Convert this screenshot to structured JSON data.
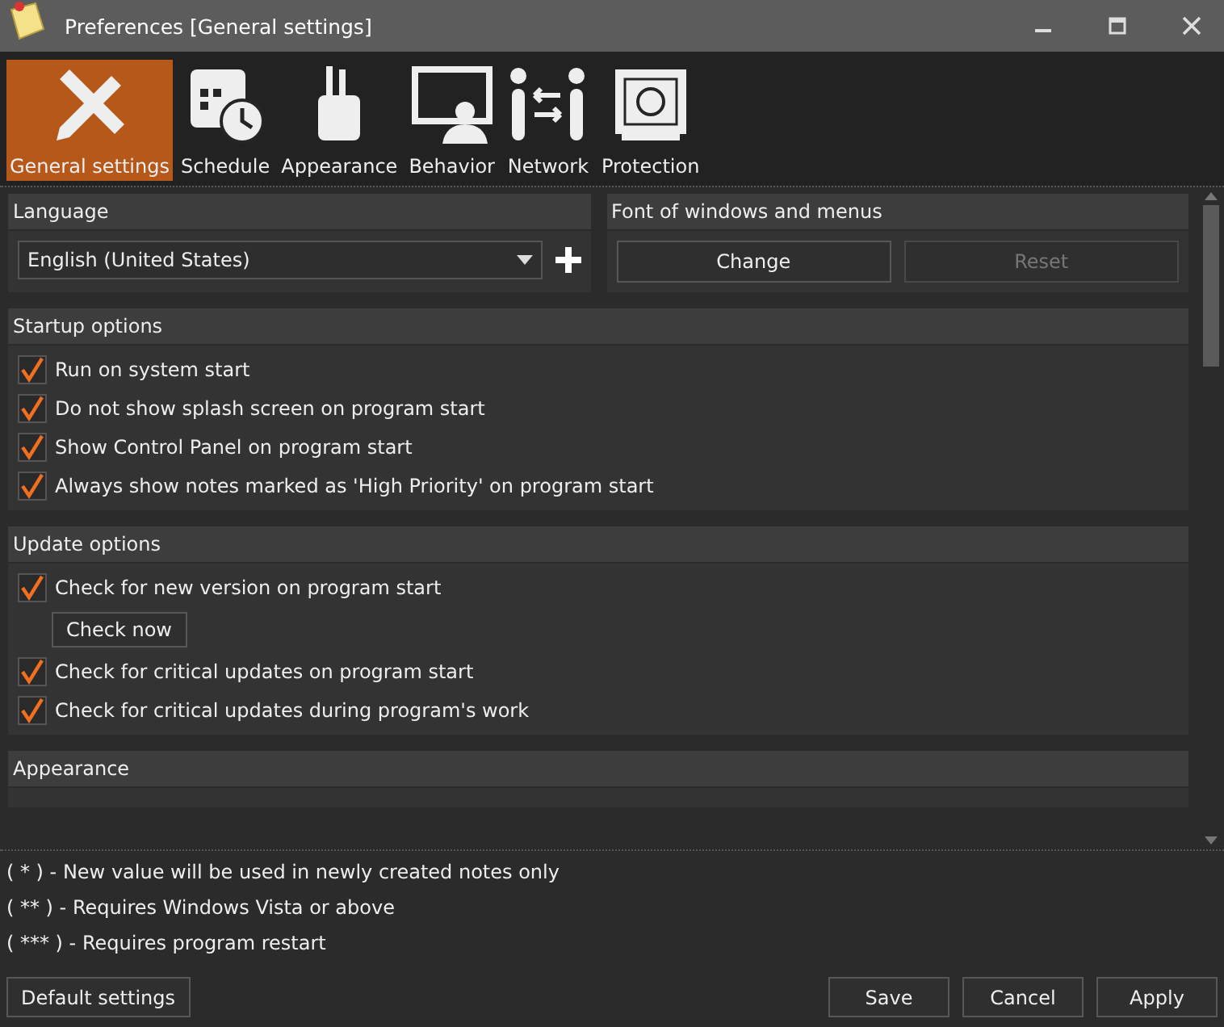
{
  "window": {
    "title": "Preferences [General settings]"
  },
  "tabs": [
    {
      "label": "General settings",
      "selected": true
    },
    {
      "label": "Schedule",
      "selected": false
    },
    {
      "label": "Appearance",
      "selected": false
    },
    {
      "label": "Behavior",
      "selected": false
    },
    {
      "label": "Network",
      "selected": false
    },
    {
      "label": "Protection",
      "selected": false
    }
  ],
  "language": {
    "header": "Language",
    "value": "English (United States)"
  },
  "font": {
    "header": "Font of windows and menus",
    "buttons": [
      {
        "label": "Change",
        "disabled": false
      },
      {
        "label": "Reset",
        "disabled": true
      }
    ]
  },
  "sections": [
    {
      "header": "Startup options",
      "items": [
        {
          "kind": "checkbox",
          "label": "Run on system start",
          "checked": true
        },
        {
          "kind": "checkbox",
          "label": "Do not show splash screen on program start",
          "checked": true
        },
        {
          "kind": "checkbox",
          "label": "Show Control Panel on program start",
          "checked": true
        },
        {
          "kind": "checkbox",
          "label": "Always show notes marked as 'High Priority' on program start",
          "checked": true
        }
      ]
    },
    {
      "header": "Update options",
      "items": [
        {
          "kind": "checkbox",
          "label": "Check for new version on program start",
          "checked": true
        },
        {
          "kind": "button",
          "label": "Check now"
        },
        {
          "kind": "checkbox",
          "label": "Check for critical updates on program start",
          "checked": true
        },
        {
          "kind": "checkbox",
          "label": "Check for critical updates during program's work",
          "checked": true
        }
      ]
    },
    {
      "header": "Appearance"
    }
  ],
  "notes": [
    "( * ) - New value will be used in newly created notes only",
    "( ** ) - Requires Windows Vista or above",
    "( *** ) - Requires program restart"
  ],
  "footer": {
    "left_button": "Default settings",
    "buttons": [
      "Save",
      "Cancel",
      "Apply"
    ]
  }
}
